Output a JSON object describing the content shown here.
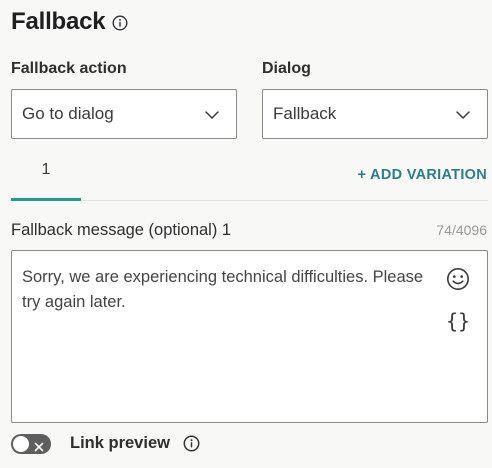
{
  "header": {
    "title": "Fallback",
    "info_icon": "info-circle-icon"
  },
  "fields": {
    "fallback_action": {
      "label": "Fallback action",
      "value": "Go to dialog",
      "icon": "chevron-down-icon"
    },
    "dialog": {
      "label": "Dialog",
      "value": "Fallback",
      "icon": "chevron-down-icon"
    }
  },
  "variations": {
    "tabs": [
      {
        "label": "1",
        "active": true
      }
    ],
    "add_label": "+ ADD VARIATION"
  },
  "message": {
    "label": "Fallback message (optional) 1",
    "char_count": "74/4096",
    "text": "Sorry, we are experiencing technical difficulties. Please try again later.",
    "emoji_icon": "smiley-icon",
    "variables_icon": "curly-braces-icon",
    "variables_glyph": "{}"
  },
  "link_preview": {
    "label": "Link preview",
    "enabled": false,
    "info_icon": "info-circle-icon"
  },
  "colors": {
    "accent": "#1f9f8b",
    "link": "#2d7d88",
    "toggle_off": "#5e5e5e",
    "background": "#f8f8f7"
  }
}
